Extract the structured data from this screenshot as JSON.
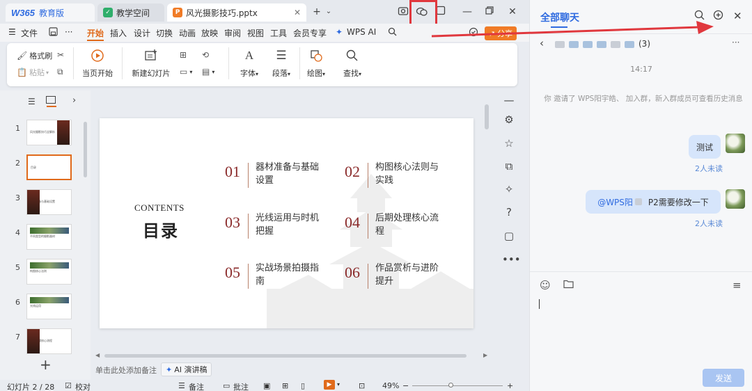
{
  "titlebar": {
    "tabs": [
      {
        "logo": "W365",
        "label": "教育版"
      },
      {
        "label": "教学空间"
      },
      {
        "label": "风光摄影技巧.pptx"
      }
    ]
  },
  "menubar": {
    "file_label": "文件",
    "items": [
      "开始",
      "插入",
      "设计",
      "切换",
      "动画",
      "放映",
      "审阅",
      "视图",
      "工具",
      "会员专享",
      "WPS AI"
    ],
    "active": "开始",
    "share_label": "分享"
  },
  "ribbon": {
    "format_painter": "格式刷",
    "paste": "粘贴",
    "play_current": "当页开始",
    "new_slide": "新建幻灯片",
    "font": "字体",
    "paragraph": "段落",
    "drawing": "绘图",
    "find": "查找"
  },
  "thumbnails": {
    "items": [
      {
        "num": "1",
        "caption": "风光摄影技巧全解析"
      },
      {
        "num": "2",
        "caption": "目录"
      },
      {
        "num": "3",
        "caption": "器材准备与基础设置"
      },
      {
        "num": "4",
        "caption": "不同类型的摄影器材"
      },
      {
        "num": "5",
        "caption": "构图核心法则"
      },
      {
        "num": "6",
        "caption": "光线运用"
      },
      {
        "num": "7",
        "caption": "后期处理核心流程"
      }
    ],
    "add_label": "+"
  },
  "slide": {
    "contents_en": "CONTENTS",
    "contents_cn": "目录",
    "toc": [
      {
        "num": "01",
        "text": "器材准备与基础设置"
      },
      {
        "num": "02",
        "text": "构图核心法则与实践"
      },
      {
        "num": "03",
        "text": "光线运用与时机把握"
      },
      {
        "num": "04",
        "text": "后期处理核心流程"
      },
      {
        "num": "05",
        "text": "实战场景拍摄指南"
      },
      {
        "num": "06",
        "text": "作品赏析与进阶提升"
      }
    ]
  },
  "notes": {
    "placeholder": "单击此处添加备注",
    "ai_label": "AI 演讲稿"
  },
  "statusbar": {
    "slide_count": "幻灯片 2 / 28",
    "proofread": "校对",
    "notes": "备注",
    "comment": "批注",
    "zoom": "49%"
  },
  "chat": {
    "title": "全部聊天",
    "group_suffix": "(3)",
    "time": "14:17",
    "system_msg": "你 邀请了 WPS阳宇皓、 加入群，新入群成员可查看历史消息",
    "messages": [
      {
        "text": "测试",
        "status": "2人未读"
      },
      {
        "mention": "@WPS阳",
        "text": "P2需要修改一下",
        "status": "2人未读"
      }
    ],
    "send_label": "发送"
  },
  "colors": {
    "accent_orange": "#e06a1b",
    "accent_blue": "#2f6be0",
    "highlight_red": "#e0383e",
    "toc_red": "#8a2a2a"
  }
}
